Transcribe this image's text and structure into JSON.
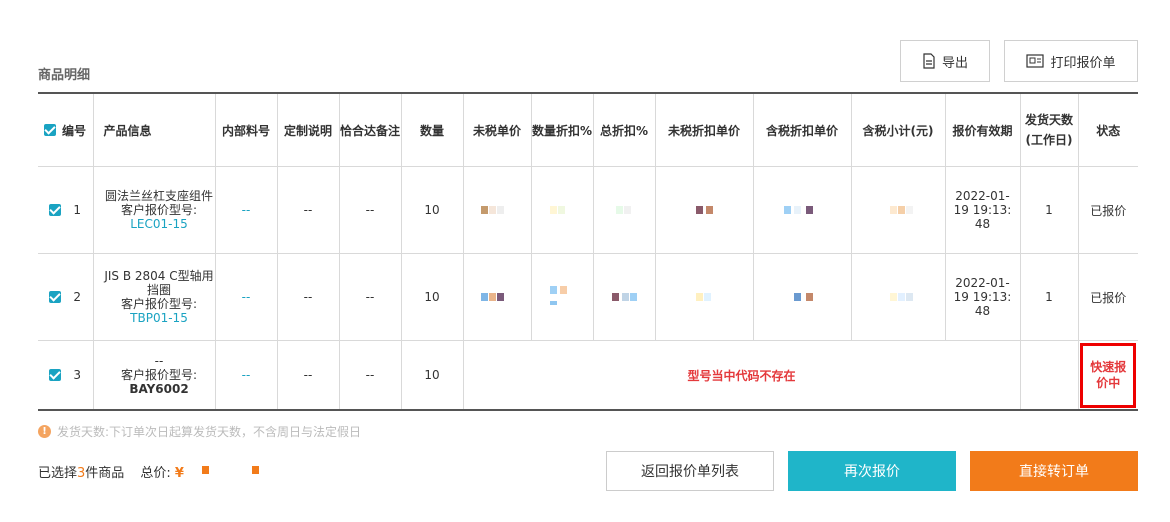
{
  "section_title": "商品明细",
  "toolbar": {
    "export_label": "导出",
    "print_label": "打印报价单"
  },
  "table": {
    "headers": {
      "no": "编号",
      "product": "产品信息",
      "internal": "内部料号",
      "custom": "定制说明",
      "note": "恰合达备注",
      "qty": "数量",
      "unit_price": "未税单价",
      "qty_discount": "数量折扣%",
      "total_discount": "总折扣%",
      "disc_unit_ex": "未税折扣单价",
      "disc_unit_inc": "含税折扣单价",
      "subtotal": "含税小计(元)",
      "validity": "报价有效期",
      "ship_days_1": "发货天数",
      "ship_days_2": "(工作日)",
      "status": "状态"
    },
    "rows": [
      {
        "no": "1",
        "name": "圆法兰丝杠支座组件",
        "model_label": "客户报价型号:",
        "model": "LEC01-15",
        "internal": "--",
        "custom": "--",
        "note": "--",
        "qty": "10",
        "validity_1": "2022-01-",
        "validity_2": "19 19:13:",
        "validity_3": "48",
        "ship_days": "1",
        "status": "已报价"
      },
      {
        "no": "2",
        "name": "JIS B 2804 C型轴用挡圈",
        "model_label": "客户报价型号:",
        "model": "TBP01-15",
        "internal": "--",
        "custom": "--",
        "note": "--",
        "qty": "10",
        "validity_1": "2022-01-",
        "validity_2": "19 19:13:",
        "validity_3": "48",
        "ship_days": "1",
        "status": "已报价"
      },
      {
        "no": "3",
        "name": "--",
        "model_label": "客户报价型号:",
        "model": "BAY6002",
        "internal": "--",
        "custom": "--",
        "note": "--",
        "qty": "10",
        "error": "型号当中代码不存在",
        "status_1": "快速报",
        "status_2": "价中"
      }
    ]
  },
  "notice": {
    "icon": "!",
    "text": "发货天数:下订单次日起算发货天数，不含周日与法定假日"
  },
  "footer": {
    "selected_prefix": "已选择",
    "selected_count": "3",
    "selected_suffix": "件商品",
    "total_label": "总价:",
    "currency": "¥",
    "back_label": "返回报价单列表",
    "requote_label": "再次报价",
    "order_label": "直接转订单"
  },
  "colors": {
    "accent": "#1aa3c2",
    "primary_button": "#1fb5c9",
    "order_button": "#f27b1a",
    "error": "#e4393c"
  }
}
